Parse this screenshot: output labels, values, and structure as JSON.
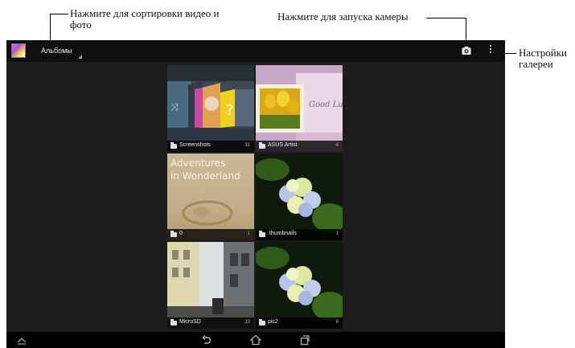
{
  "callouts": {
    "sort": "Нажмите для сортировки видео и\nфото",
    "camera": "Нажмите для запуска камеры",
    "settings": "Настройки\nгалереи"
  },
  "action_bar": {
    "app_icon": "gallery-app-icon",
    "albums_label": "Альбомы",
    "camera_icon": "camera-icon",
    "menu_icon": "overflow-menu-icon"
  },
  "albums": [
    {
      "name": "Screenshots",
      "count": "31"
    },
    {
      "name": "ASUS Artist",
      "count": "4"
    },
    {
      "name": "0",
      "count": "1"
    },
    {
      "name": ".thumbnails",
      "count": "1"
    },
    {
      "name": "MicroSD",
      "count": "10"
    },
    {
      "name": "pic2",
      "count": "8"
    }
  ],
  "wonderland_art_text": "Adventures\nin Wonderland",
  "artist_art_text": "Good Lu",
  "nav_bar": {
    "left": "collapse-icon",
    "back": "back-icon",
    "home": "home-icon",
    "recent": "recent-apps-icon"
  }
}
